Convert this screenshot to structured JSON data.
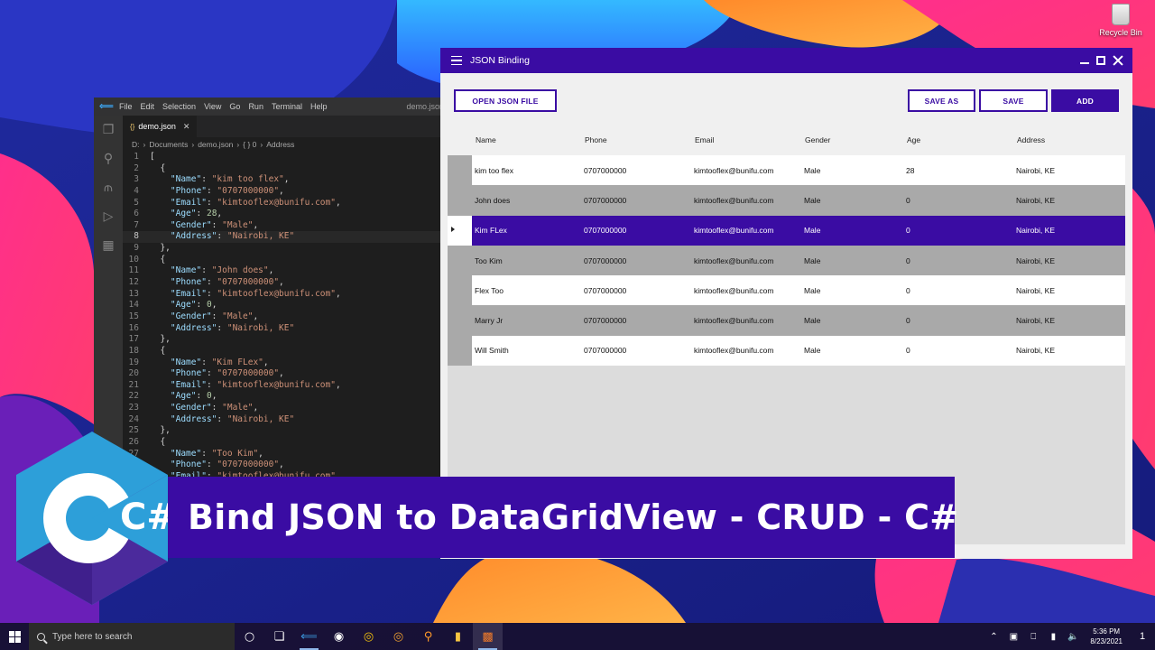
{
  "desktop": {
    "recycle_bin_label": "Recycle Bin"
  },
  "vscode": {
    "menu": [
      "File",
      "Edit",
      "Selection",
      "View",
      "Go",
      "Run",
      "Terminal",
      "Help"
    ],
    "window_title_fragment": "demo.json",
    "tab_label": "demo.json",
    "breadcrumb": [
      "D:",
      "Documents",
      "demo.json",
      "{ } 0",
      "Address"
    ],
    "current_line": 8,
    "code_lines": [
      "[",
      "  {",
      "    \"Name\": \"kim too flex\",",
      "    \"Phone\": \"0707000000\",",
      "    \"Email\": \"kimtooflex@bunifu.com\",",
      "    \"Age\": 28,",
      "    \"Gender\": \"Male\",",
      "    \"Address\": \"Nairobi, KE\"",
      "  },",
      "  {",
      "    \"Name\": \"John does\",",
      "    \"Phone\": \"0707000000\",",
      "    \"Email\": \"kimtooflex@bunifu.com\",",
      "    \"Age\": 0,",
      "    \"Gender\": \"Male\",",
      "    \"Address\": \"Nairobi, KE\"",
      "  },",
      "  {",
      "    \"Name\": \"Kim FLex\",",
      "    \"Phone\": \"0707000000\",",
      "    \"Email\": \"kimtooflex@bunifu.com\",",
      "    \"Age\": 0,",
      "    \"Gender\": \"Male\",",
      "    \"Address\": \"Nairobi, KE\"",
      "  },",
      "  {",
      "    \"Name\": \"Too Kim\",",
      "    \"Phone\": \"0707000000\",",
      "    \"Email\": \"kimtooflex@bunifu.com\","
    ]
  },
  "app": {
    "title": "JSON Binding",
    "buttons": {
      "open": "OPEN JSON FILE",
      "save_as": "SAVE AS",
      "save": "SAVE",
      "add": "ADD"
    },
    "accent_color": "#3a0ca3",
    "columns": [
      "Name",
      "Phone",
      "Email",
      "Gender",
      "Age",
      "Address"
    ],
    "selected_row": 2,
    "rows": [
      [
        "kim too flex",
        "0707000000",
        "kimtooflex@bunifu.com",
        "Male",
        "28",
        "Nairobi, KE"
      ],
      [
        "John does",
        "0707000000",
        "kimtooflex@bunifu.com",
        "Male",
        "0",
        "Nairobi, KE"
      ],
      [
        "Kim FLex",
        "0707000000",
        "kimtooflex@bunifu.com",
        "Male",
        "0",
        "Nairobi, KE"
      ],
      [
        "Too Kim",
        "0707000000",
        "kimtooflex@bunifu.com",
        "Male",
        "0",
        "Nairobi, KE"
      ],
      [
        "Flex Too",
        "0707000000",
        "kimtooflex@bunifu.com",
        "Male",
        "0",
        "Nairobi, KE"
      ],
      [
        "Marry Jr",
        "0707000000",
        "kimtooflex@bunifu.com",
        "Male",
        "0",
        "Nairobi, KE"
      ],
      [
        "Will Smith",
        "0707000000",
        "kimtooflex@bunifu.com",
        "Male",
        "0",
        "Nairobi, KE"
      ]
    ]
  },
  "overlay": {
    "logo_text": "C#",
    "banner_text": "Bind JSON to DataGridView - CRUD - C#"
  },
  "taskbar": {
    "search_placeholder": "Type here to search",
    "time": "5:36 PM",
    "date": "8/23/2021",
    "notification_count": "1"
  }
}
